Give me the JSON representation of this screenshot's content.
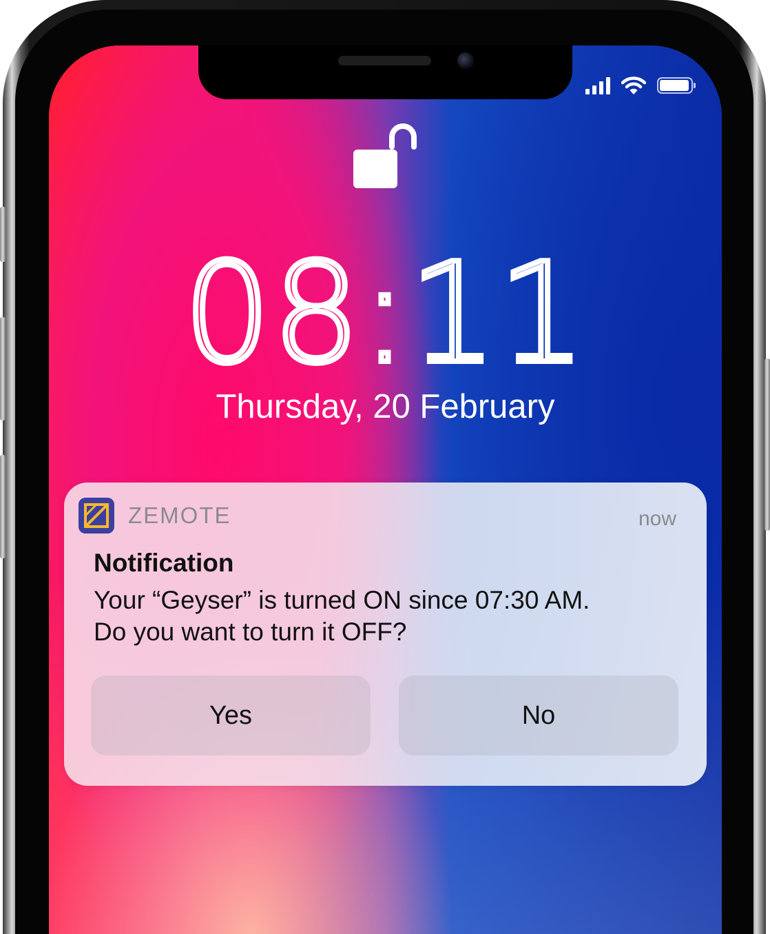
{
  "status_bar": {
    "signal_icon": "cellular-signal-icon",
    "wifi_icon": "wifi-icon",
    "battery_icon": "battery-icon",
    "battery_level": 0.95
  },
  "lock_screen": {
    "lock_icon": "unlocked-padlock-icon",
    "time_hours": "08",
    "time_minutes": "11",
    "date": "Thursday, 20 February"
  },
  "notification": {
    "app_icon": "zemote-app-icon",
    "app_name": "ZEMOTE",
    "time": "now",
    "title": "Notification",
    "body_line1": "Your “Geyser” is turned ON since 07:30 AM.",
    "body_line2": "Do you want to turn it OFF?",
    "actions": [
      {
        "label": "Yes"
      },
      {
        "label": "No"
      }
    ]
  },
  "colors": {
    "app_icon_bg": "#3d3fa0",
    "app_icon_mark": "#f5b82e",
    "wallpaper_red": "#ff1e4a",
    "wallpaper_pink": "#f01478",
    "wallpaper_blue": "#0b2ea6"
  }
}
